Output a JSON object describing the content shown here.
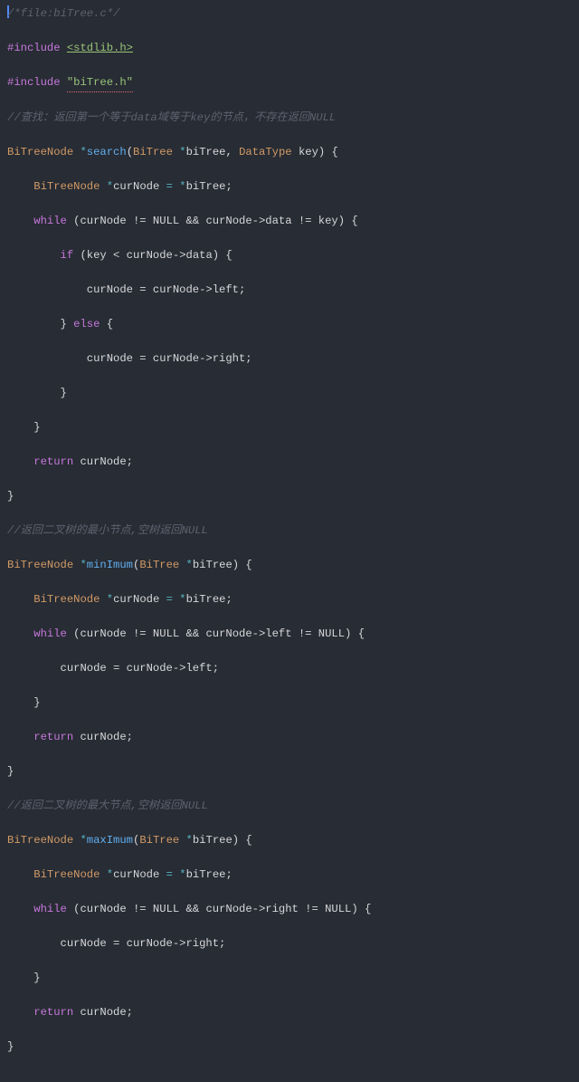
{
  "file_header_comment": "/*file:biTree.c*/",
  "include1": {
    "kw": "#include",
    "val": "<stdlib.h>"
  },
  "include2": {
    "kw": "#include",
    "val": "\"biTree.h\""
  },
  "search_comment": "//查找：返回第一个等于data域等于key的节点，不存在返回NULL",
  "search_sig": {
    "type": "BiTreeNode",
    "star": "*",
    "name": "search",
    "p1_type": "BiTree",
    "p1_name": "biTree",
    "p2_type": "DataType",
    "p2_name": "key"
  },
  "decl": {
    "type": "BiTreeNode",
    "star": "*",
    "name": "curNode",
    "eq": "=",
    "starr": "*",
    "src": "biTree"
  },
  "loop1": {
    "kw": "while",
    "cond": "(curNode != NULL && curNode->data != key)"
  },
  "if1": {
    "kw": "if",
    "cond": "(key < curNode->data)"
  },
  "assign_left": "curNode = curNode->left;",
  "assign_right": "curNode = curNode->right;",
  "else_kw": "else",
  "ret": "return curNode;",
  "min_comment": "//返回二叉树的最小节点,空树返回NULL",
  "min_sig": {
    "type": "BiTreeNode",
    "star": "*",
    "name": "minImum",
    "p1_type": "BiTree",
    "p1_name": "biTree"
  },
  "loop2": {
    "kw": "while",
    "cond": "(curNode != NULL && curNode->left != NULL)"
  },
  "max_comment": "//返回二叉树的最大节点,空树返回NULL",
  "max_sig": {
    "type": "BiTreeNode",
    "star": "*",
    "name": "maxImum",
    "p1_type": "BiTree",
    "p1_name": "biTree"
  },
  "loop3": {
    "kw": "while",
    "cond": "(curNode != NULL && curNode->right != NULL)"
  },
  "brace_open": "{",
  "brace_close": "}",
  "brace_close_else": "} ",
  "chart_data": null
}
